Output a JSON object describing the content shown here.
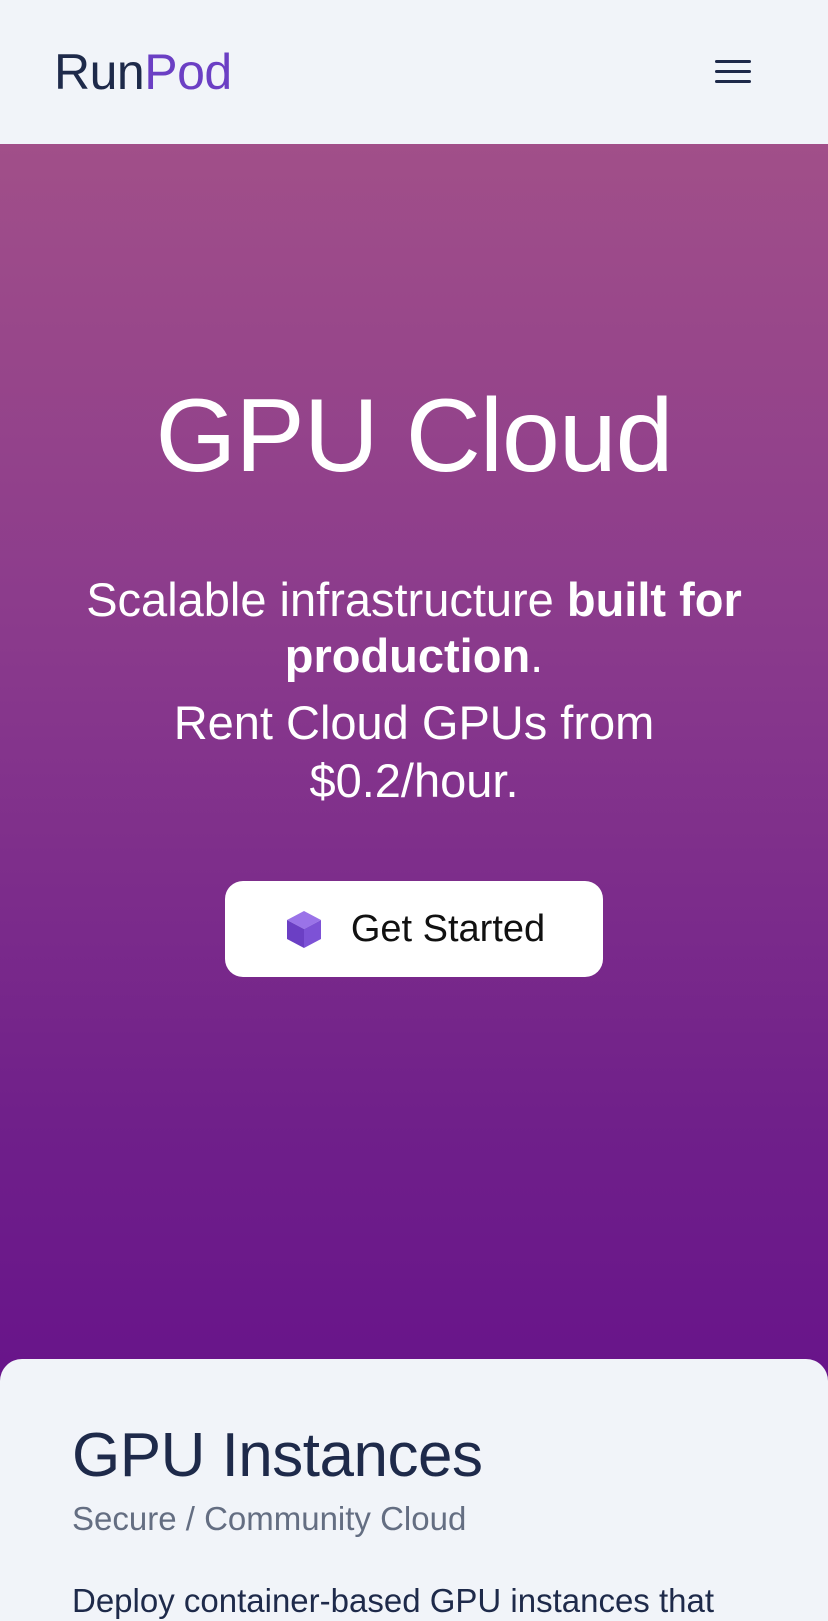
{
  "header": {
    "logo_part1": "Run",
    "logo_part2": "Pod",
    "menu_icon": "hamburger-menu-icon"
  },
  "hero": {
    "title": "GPU Cloud",
    "subtitle_plain": "Scalable infrastructure ",
    "subtitle_bold": "built for production",
    "subtitle_end": ".",
    "price_line": "Rent Cloud GPUs from $0.2/hour.",
    "cta_label": "Get Started",
    "cta_icon": "cube-icon"
  },
  "section": {
    "title": "GPU Instances",
    "subtitle": "Secure / Community Cloud",
    "body_partial": "Deploy container-based GPU instances that"
  },
  "colors": {
    "brand_dark": "#1e2a4a",
    "brand_purple": "#6b3fc4",
    "hero_top": "#a14f89",
    "hero_bottom": "#68148a"
  }
}
